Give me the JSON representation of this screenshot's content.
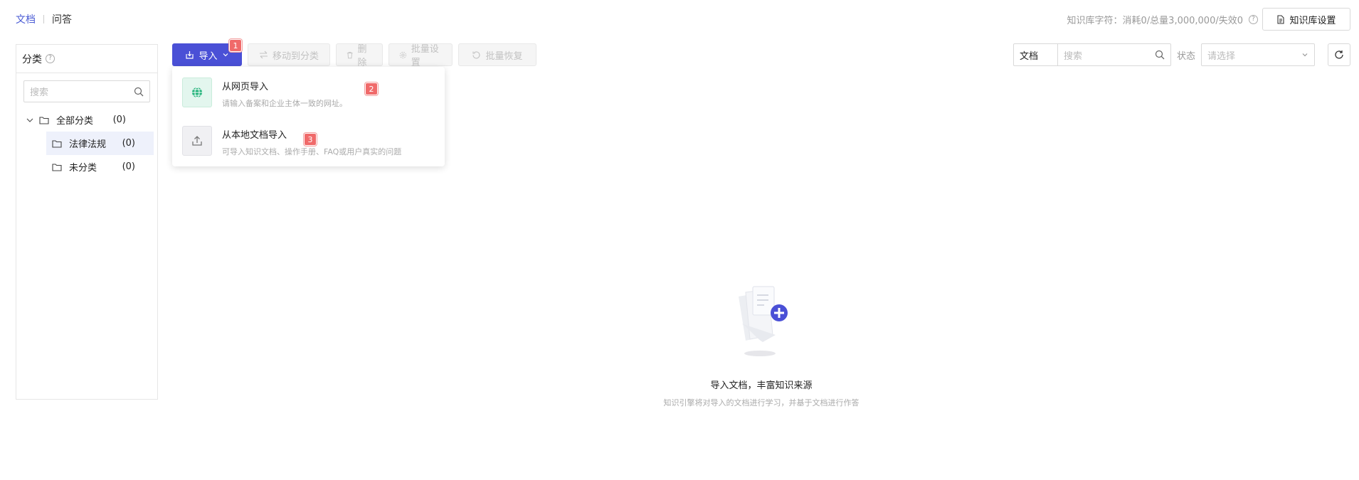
{
  "top_tabs": [
    {
      "label": "文档",
      "active": true
    },
    {
      "label": "问答",
      "active": false
    }
  ],
  "kb_info": {
    "usage_text": "知识库字符：消耗0/总量3,000,000/失效0",
    "help_icon": "question-circle-icon"
  },
  "kb_settings": {
    "label": "知识库设置",
    "icon": "document-icon"
  },
  "sidebar": {
    "title": "分类",
    "search_placeholder": "搜索",
    "tree": {
      "root": {
        "label": "全部分类",
        "count": "(0)"
      },
      "children": [
        {
          "label": "法律法规",
          "count": "(0)",
          "selected": true
        },
        {
          "label": "未分类",
          "count": "(0)",
          "selected": false
        }
      ]
    }
  },
  "toolbar": {
    "import_label": "导入",
    "move_label": "移动到分类",
    "delete_label": "删除",
    "batch_settings_label": "批量设置",
    "batch_restore_label": "批量恢复"
  },
  "import_menu": {
    "items": [
      {
        "title": "从网页导入",
        "desc": "请输入备案和企业主体一致的网址。",
        "icon": "globe-icon"
      },
      {
        "title": "从本地文档导入",
        "desc": "可导入知识文档、操作手册、FAQ或用户真实的问题",
        "icon": "upload-icon"
      }
    ]
  },
  "markers": [
    "1",
    "2",
    "3"
  ],
  "filters": {
    "type_value": "文档",
    "search_placeholder": "搜索",
    "status_label": "状态",
    "status_placeholder": "请选择"
  },
  "empty_state": {
    "title": "导入文档，丰富知识来源",
    "subtitle": "知识引擎将对导入的文档进行学习，并基于文档进行作答"
  },
  "colors": {
    "primary": "#4a50d6",
    "active_tab": "#4a5bd4",
    "marker": "#f06a6a",
    "selected_row": "#eef1fb"
  }
}
